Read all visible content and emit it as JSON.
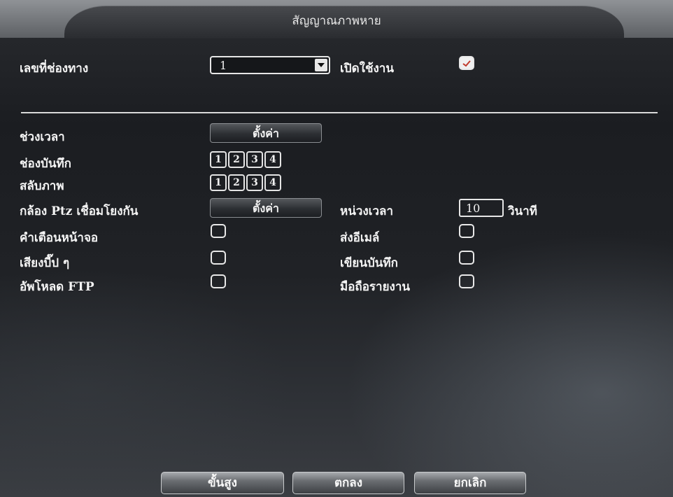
{
  "window": {
    "title": "สัญญาณภาพหาย"
  },
  "channel": {
    "label": "เลขที่ช่องทาง",
    "value": "1",
    "enable_label": "เปิดใช้งาน",
    "enabled": true
  },
  "rows": {
    "period": {
      "label": "ช่วงเวลา",
      "button": "ตั้งค่า"
    },
    "record": {
      "label": "ช่องบันทึก",
      "channels": [
        "1",
        "2",
        "3",
        "4"
      ]
    },
    "tour": {
      "label": "สลับภาพ",
      "channels": [
        "1",
        "2",
        "3",
        "4"
      ]
    },
    "ptz": {
      "label": "กล้อง Ptz เชื่อมโยงกัน",
      "button": "ตั้งค่า"
    },
    "delay": {
      "label": "หน่วงเวลา",
      "value": "10",
      "unit": "วินาที"
    },
    "screen_tip": {
      "label": "คำเตือนหน้าจอ",
      "checked": false
    },
    "send_email": {
      "label": "ส่งอีเมล์",
      "checked": false
    },
    "buzzer": {
      "label": "เสียงบี๊ป ๆ",
      "checked": false
    },
    "write_log": {
      "label": "เขียนบันทึก",
      "checked": false
    },
    "ftp_upload": {
      "label": "อัพโหลด FTP",
      "checked": false
    },
    "mobile_report": {
      "label": "มือถือรายงาน",
      "checked": false
    }
  },
  "footer": {
    "advanced": "ขั้นสูง",
    "ok": "ตกลง",
    "cancel": "ยกเลิก"
  },
  "colors": {
    "check_mark": "#c0392b"
  }
}
